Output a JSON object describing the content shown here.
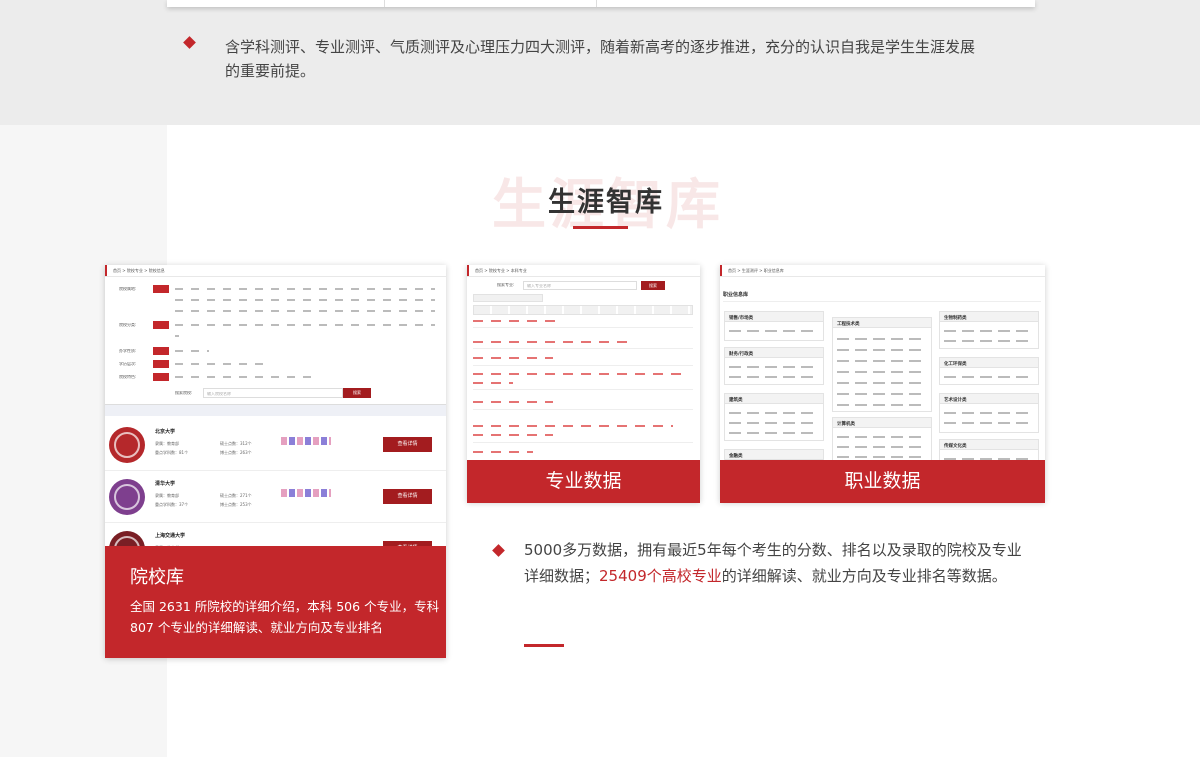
{
  "top": {
    "description": "含学科测评、专业测评、气质测评及心理压力四大测评，随着新高考的逐步推进，充分的认识自我是学生生涯发展的重要前提。"
  },
  "section": {
    "title_bg": "生涯智库",
    "title": "生涯智库"
  },
  "card_school": {
    "breadcrumb": "首页 > 院校专业 > 院校信息",
    "filters": [
      {
        "label": "院校属地:"
      },
      {
        "label": "院校分类:"
      },
      {
        "label": "办学性质:"
      },
      {
        "label": "学历层次:"
      },
      {
        "label": "院校特色:"
      }
    ],
    "search_label": "搜索院校:",
    "search_placeholder": "输入院校名称",
    "search_button": "搜索",
    "universities": [
      {
        "name": "北京大学",
        "info1": "隶属：教育部",
        "info2": "重点学科数：81个",
        "info3": "硕士点数：312个",
        "info4": "博士点数：263个",
        "button": "查看详情"
      },
      {
        "name": "清华大学",
        "info1": "隶属：教育部",
        "info2": "重点学科数：37个",
        "info3": "硕士点数：271个",
        "info4": "博士点数：253个",
        "button": "查看详情"
      },
      {
        "name": "上海交通大学",
        "info1": "隶属：教育部",
        "info2": "",
        "info3": "",
        "info4": "",
        "button": "查看详情"
      }
    ],
    "overlay_title": "院校库",
    "overlay_text": "全国 2631 所院校的详细介绍，本科 506 个专业，专科 807 个专业的详细解读、就业方向及专业排名"
  },
  "card_major": {
    "breadcrumb": "首页 > 院校专业 > 本科专业",
    "search_label": "搜索专业:",
    "search_placeholder": "输入专业名称",
    "search_button": "搜索",
    "band_label": "专业数据"
  },
  "card_career": {
    "breadcrumb": "首页 > 生涯测评 > 职业信息库",
    "heading": "职业信息库",
    "boxes": [
      "销售/市场类",
      "工程技术类",
      "生物制药类",
      "财务/行政类",
      "化工环保类",
      "建筑类",
      "艺术设计类",
      "计算机类",
      "传媒文化类",
      "金融类"
    ],
    "band_label": "职业数据"
  },
  "bottom": {
    "text_before": "5000多万数据，拥有最近5年每个考生的分数、排名以及录取的院校及专业详细数据；",
    "text_highlight": "25409个高校专业",
    "text_after": "的详细解读、就业方向及专业排名等数据。"
  },
  "colors": {
    "accent": "#c3272b",
    "dark_red": "#a31c1f",
    "band_gray": "#ececec"
  }
}
